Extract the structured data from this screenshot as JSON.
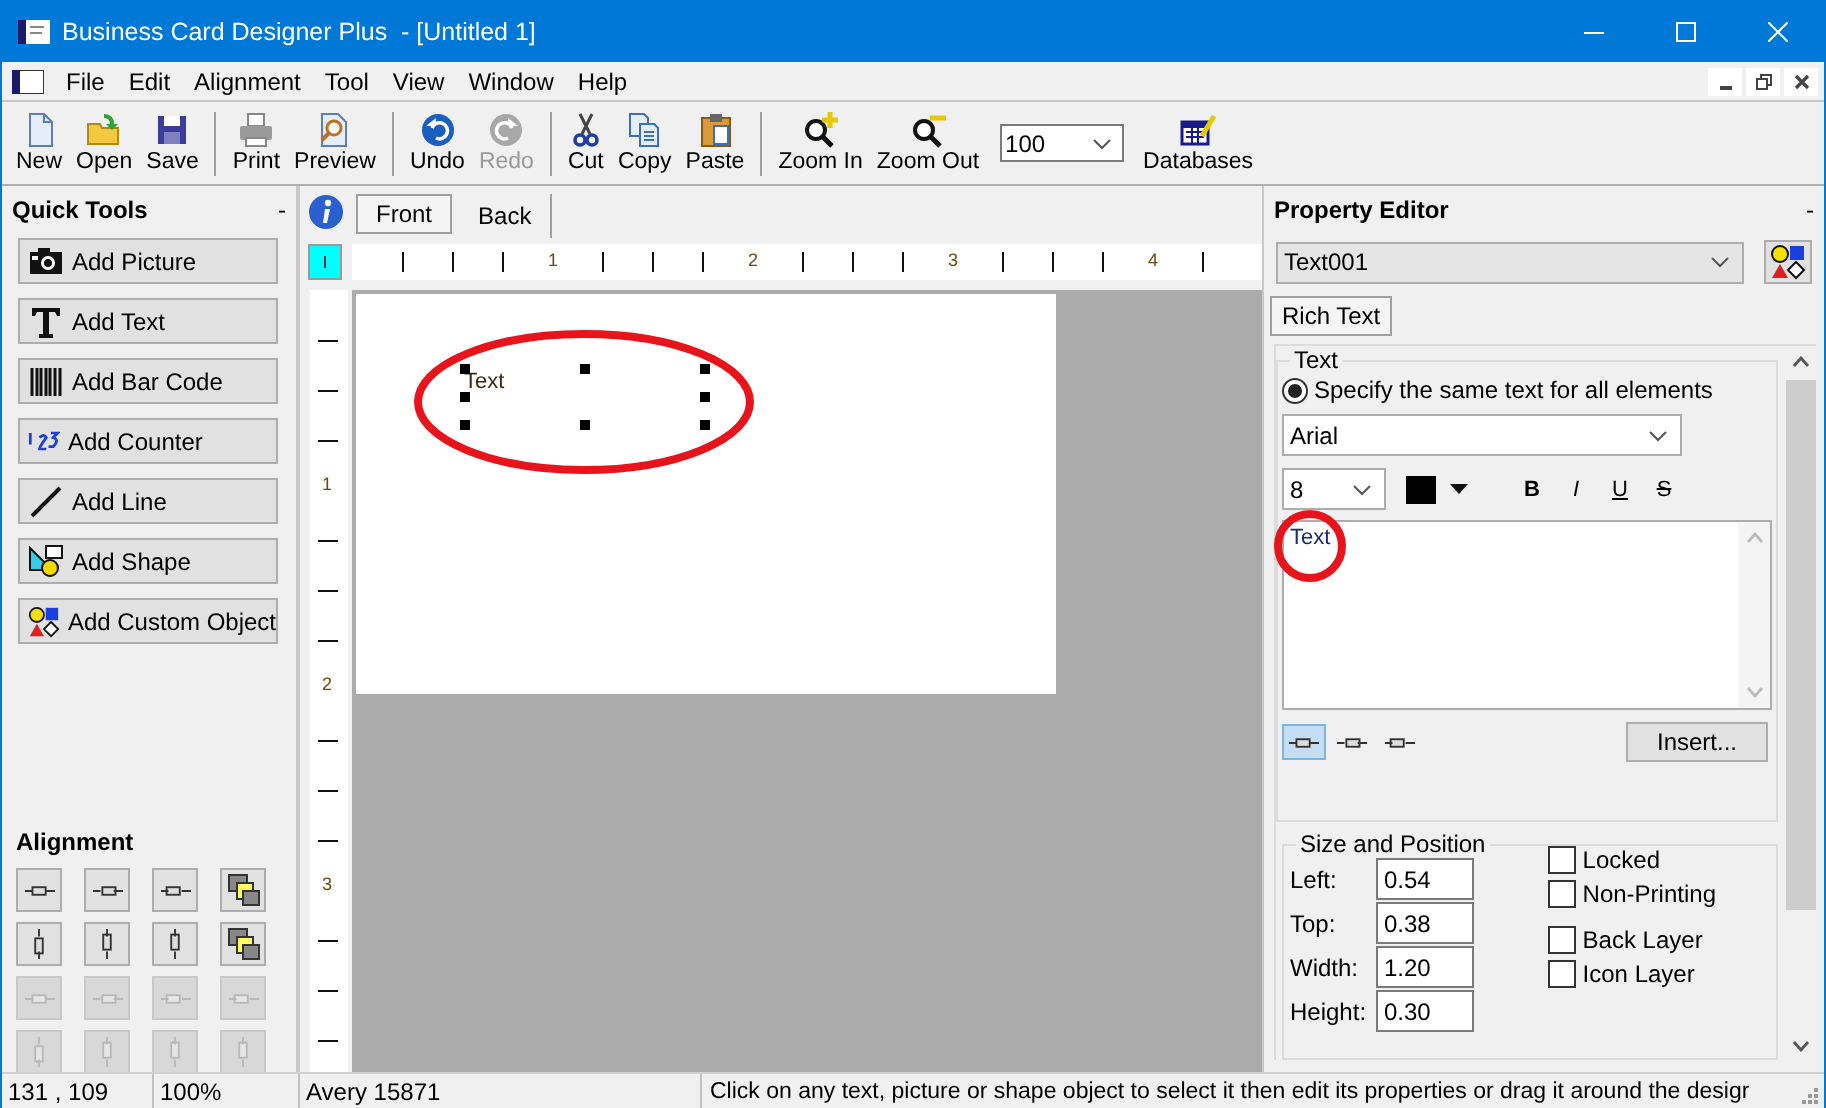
{
  "window": {
    "title": "Business Card Designer Plus  - [Untitled 1]"
  },
  "menu": [
    "File",
    "Edit",
    "Alignment",
    "Tool",
    "View",
    "Window",
    "Help"
  ],
  "toolbar": [
    {
      "kind": "button",
      "label": "New",
      "disabled": false
    },
    {
      "kind": "button",
      "label": "Open",
      "disabled": false
    },
    {
      "kind": "button",
      "label": "Save",
      "disabled": false
    },
    {
      "kind": "separator"
    },
    {
      "kind": "button",
      "label": "Print",
      "disabled": false
    },
    {
      "kind": "button",
      "label": "Preview",
      "disabled": false
    },
    {
      "kind": "separator"
    },
    {
      "kind": "button",
      "label": "Undo",
      "disabled": false
    },
    {
      "kind": "button",
      "label": "Redo",
      "disabled": true
    },
    {
      "kind": "separator"
    },
    {
      "kind": "button",
      "label": "Cut",
      "disabled": false
    },
    {
      "kind": "button",
      "label": "Copy",
      "disabled": false
    },
    {
      "kind": "button",
      "label": "Paste",
      "disabled": false
    },
    {
      "kind": "separator"
    },
    {
      "kind": "button",
      "label": "Zoom In",
      "disabled": false
    },
    {
      "kind": "button",
      "label": "Zoom Out",
      "disabled": false
    },
    {
      "kind": "combo",
      "value": "100"
    },
    {
      "kind": "button",
      "label": "Databases",
      "disabled": false
    }
  ],
  "quick_tools": {
    "title": "Quick Tools",
    "collapse": "-",
    "buttons": [
      {
        "label": "Add Picture"
      },
      {
        "label": "Add Text"
      },
      {
        "label": "Add Bar Code"
      },
      {
        "label": "Add Counter"
      },
      {
        "label": "Add Line"
      },
      {
        "label": "Add Shape"
      },
      {
        "label": "Add Custom Object"
      }
    ]
  },
  "alignment": {
    "title": "Alignment",
    "buttons": [
      {
        "disabled": false
      },
      {
        "disabled": false
      },
      {
        "disabled": false
      },
      {
        "disabled": false
      },
      {
        "disabled": false
      },
      {
        "disabled": false
      },
      {
        "disabled": false
      },
      {
        "disabled": false
      },
      {
        "disabled": true
      },
      {
        "disabled": true
      },
      {
        "disabled": true
      },
      {
        "disabled": true
      },
      {
        "disabled": true
      },
      {
        "disabled": true
      },
      {
        "disabled": true
      },
      {
        "disabled": true
      }
    ]
  },
  "document_tabs": [
    {
      "label": "Front",
      "selected": true
    },
    {
      "label": "Back",
      "selected": false
    }
  ],
  "ruler": {
    "horizontal": [
      "1",
      "2",
      "3",
      "4"
    ],
    "vertical": [
      "1",
      "2",
      "3"
    ]
  },
  "canvas": {
    "object_text": "Text",
    "selected": true,
    "highlighted": true
  },
  "property_editor": {
    "title": "Property Editor",
    "collapse": "-",
    "object": "Text001",
    "tabs": [
      {
        "label": "Rich Text",
        "selected": true
      }
    ],
    "text_group": {
      "title": "Text",
      "radio": {
        "label": "Specify the same text for all elements",
        "checked": true
      },
      "font": "Arial",
      "size": "8",
      "styles": [
        "B",
        "I",
        "U",
        "S"
      ],
      "content": "Text",
      "highlighted": true,
      "alignments": [
        {
          "selected": true
        },
        {
          "selected": false
        },
        {
          "selected": false
        }
      ],
      "insert_button": "Insert..."
    },
    "size_group": {
      "title": "Size and Position",
      "fields": [
        {
          "label": "Left:",
          "value": "0.54"
        },
        {
          "label": "Top:",
          "value": "0.38"
        },
        {
          "label": "Width:",
          "value": "1.20"
        },
        {
          "label": "Height:",
          "value": "0.30"
        }
      ],
      "checkboxes": [
        {
          "label": "Locked",
          "checked": false
        },
        {
          "label": "Non-Printing",
          "checked": false
        },
        {
          "label": "Back Layer",
          "checked": false
        },
        {
          "label": "Icon Layer",
          "checked": false
        }
      ]
    }
  },
  "status_bar": [
    "131 , 109",
    "100%",
    "Avery 15871",
    "Click on any text, picture or shape object to select it then edit its properties or drag it around the desigr"
  ]
}
